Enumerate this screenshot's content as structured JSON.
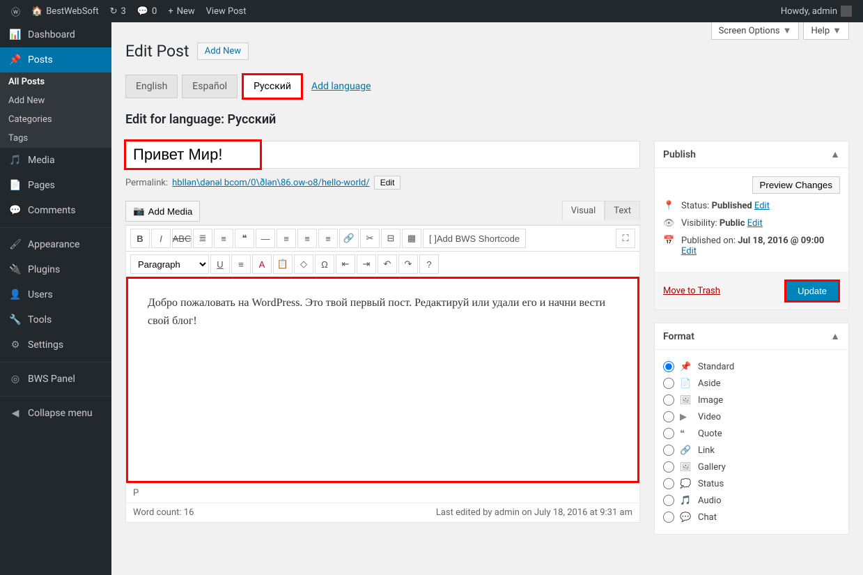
{
  "adminbar": {
    "site": "BestWebSoft",
    "updates": "3",
    "comments": "0",
    "new": "New",
    "view_post": "View Post",
    "howdy": "Howdy, admin"
  },
  "sidebar": {
    "dashboard": "Dashboard",
    "posts": "Posts",
    "posts_sub": {
      "all": "All Posts",
      "add": "Add New",
      "cat": "Categories",
      "tags": "Tags"
    },
    "media": "Media",
    "pages": "Pages",
    "comments": "Comments",
    "appearance": "Appearance",
    "plugins": "Plugins",
    "users": "Users",
    "tools": "Tools",
    "settings": "Settings",
    "bws": "BWS Panel",
    "collapse": "Collapse menu"
  },
  "top": {
    "screen_options": "Screen Options",
    "help": "Help"
  },
  "header": {
    "title": "Edit Post",
    "add_new": "Add New"
  },
  "tabs": {
    "en": "English",
    "es": "Español",
    "ru": "Русский",
    "add": "Add language"
  },
  "edit_for": "Edit for language: Русский",
  "post": {
    "title": "Привет Мир!",
    "permalink_label": "Permalink:",
    "permalink_url": "hbllən\\dənəl bcom/0\\ðlən\\86.ow-o8/hello-world/",
    "edit_btn": "Edit",
    "add_media": "Add Media",
    "visual": "Visual",
    "text": "Text",
    "paragraph": "Paragraph",
    "shortcode_btn": "Add BWS Shortcode",
    "content": "Добро пожаловать на WordPress. Это твой первый пост. Редактируй или удали его и начни вести свой блог!",
    "path": "P",
    "wordcount": "Word count: 16",
    "lastedit": "Last edited by admin on July 18, 2016 at 9:31 am"
  },
  "publish": {
    "heading": "Publish",
    "preview": "Preview Changes",
    "status_label": "Status:",
    "status_value": "Published",
    "visibility_label": "Visibility:",
    "visibility_value": "Public",
    "date_label": "Published on:",
    "date_value": "Jul 18, 2016 @ 09:00",
    "edit": "Edit",
    "trash": "Move to Trash",
    "update": "Update"
  },
  "format": {
    "heading": "Format",
    "options": {
      "standard": "Standard",
      "aside": "Aside",
      "image": "Image",
      "video": "Video",
      "quote": "Quote",
      "link": "Link",
      "gallery": "Gallery",
      "status": "Status",
      "audio": "Audio",
      "chat": "Chat"
    }
  }
}
